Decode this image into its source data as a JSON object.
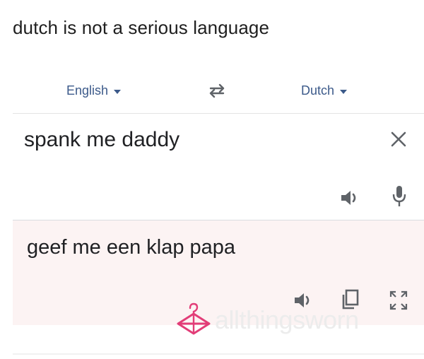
{
  "caption": "dutch is not a serious language",
  "languages": {
    "source": "English",
    "target": "Dutch"
  },
  "source": {
    "text": "spank me daddy"
  },
  "result": {
    "text": "geef me een klap papa"
  },
  "watermark": {
    "text": "allthingsworn"
  },
  "colors": {
    "language_label": "#3c5a8a",
    "result_background": "#fcf3f3",
    "watermark_logo": "#e23d78"
  },
  "icons": {
    "swap": "swap-arrows-icon",
    "clear": "close-icon",
    "speaker": "speaker-icon",
    "mic": "microphone-icon",
    "copy": "copy-icon",
    "fullscreen": "fullscreen-icon"
  }
}
